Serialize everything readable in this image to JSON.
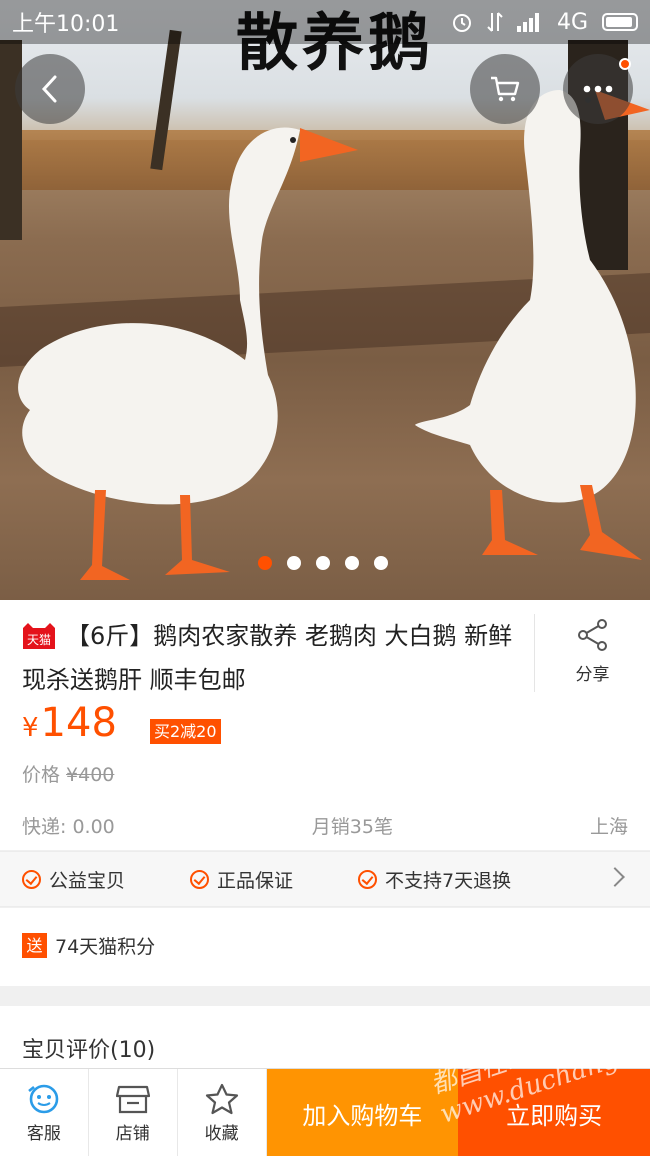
{
  "status_bar": {
    "time": "上午10:01",
    "network": "4G"
  },
  "hero": {
    "overlay_text": "散养鹅",
    "slide_count": 5,
    "active_slide": 0
  },
  "nav": {
    "back_icon": "chevron-left-icon",
    "cart_icon": "cart-icon",
    "more_icon": "more-dots-icon"
  },
  "product": {
    "badge": "天猫",
    "title": "【6斤】鹅肉农家散养 老鹅肉 大白鹅 新鲜现杀送鹅肝 顺丰包邮",
    "share_label": "分享",
    "price_symbol": "¥",
    "price": "148",
    "promo_tag": "买2减20",
    "original_price_label": "价格",
    "original_price": "¥400",
    "shipping": "快递: 0.00",
    "monthly_sales": "月销35笔",
    "location": "上海"
  },
  "services": [
    "公益宝贝",
    "正品保证",
    "不支持7天退换"
  ],
  "points": {
    "badge": "送",
    "text": "74天猫积分"
  },
  "reviews": {
    "title": "宝贝评价(10)"
  },
  "bottom_bar": {
    "service_label": "客服",
    "shop_label": "店铺",
    "favorite_label": "收藏",
    "add_to_cart": "加入购物车",
    "buy_now": "立即购买"
  },
  "watermark": "都昌在线 www.duchang.cc",
  "colors": {
    "accent": "#ff5000",
    "cart_button": "#ff9402"
  }
}
